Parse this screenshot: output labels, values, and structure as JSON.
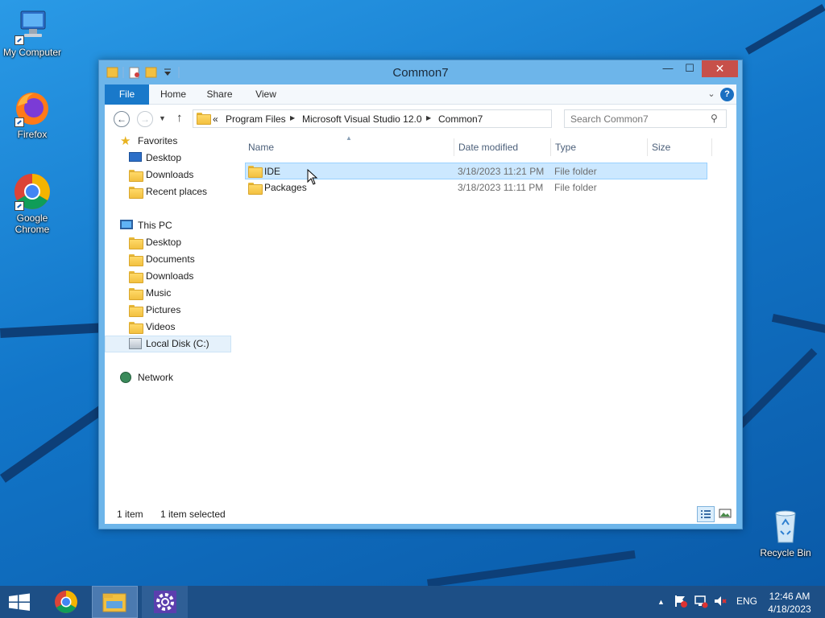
{
  "desktop": {
    "icons": [
      {
        "label": "My Computer"
      },
      {
        "label": "Firefox"
      },
      {
        "label": "Google Chrome"
      },
      {
        "label": "Recycle Bin"
      }
    ]
  },
  "window": {
    "title": "Common7",
    "close_glyph": "✕",
    "maximize_glyph": "☐",
    "minimize_glyph": "—"
  },
  "ribbon": {
    "tabs": [
      {
        "label": "File"
      },
      {
        "label": "Home"
      },
      {
        "label": "Share"
      },
      {
        "label": "View"
      }
    ],
    "help_glyph": "?"
  },
  "navigation": {
    "breadcrumb_prefix": "«",
    "breadcrumbs": [
      {
        "label": "Program Files"
      },
      {
        "label": "Microsoft Visual Studio 12.0"
      },
      {
        "label": "Common7"
      }
    ],
    "search_placeholder": "Search Common7"
  },
  "nav_pane": {
    "favorites_header": "Favorites",
    "favorites": [
      {
        "label": "Desktop"
      },
      {
        "label": "Downloads"
      },
      {
        "label": "Recent places"
      }
    ],
    "this_pc_header": "This PC",
    "this_pc": [
      {
        "label": "Desktop"
      },
      {
        "label": "Documents"
      },
      {
        "label": "Downloads"
      },
      {
        "label": "Music"
      },
      {
        "label": "Pictures"
      },
      {
        "label": "Videos"
      },
      {
        "label": "Local Disk (C:)"
      }
    ],
    "network_header": "Network"
  },
  "file_list": {
    "columns": [
      {
        "label": "Name"
      },
      {
        "label": "Date modified"
      },
      {
        "label": "Type"
      },
      {
        "label": "Size"
      }
    ],
    "rows": [
      {
        "name": "IDE",
        "date_modified": "3/18/2023 11:21 PM",
        "type": "File folder",
        "size": "",
        "selected": true
      },
      {
        "name": "Packages",
        "date_modified": "3/18/2023 11:11 PM",
        "type": "File folder",
        "size": "",
        "selected": false
      }
    ]
  },
  "status_bar": {
    "item_count": "1 item",
    "selection": "1 item selected"
  },
  "taskbar": {
    "language": "ENG",
    "time": "12:46 AM",
    "date": "4/18/2023"
  },
  "colors": {
    "accent": "#1979ca",
    "selection": "#cce8ff",
    "taskbar": "#1d4f86"
  }
}
